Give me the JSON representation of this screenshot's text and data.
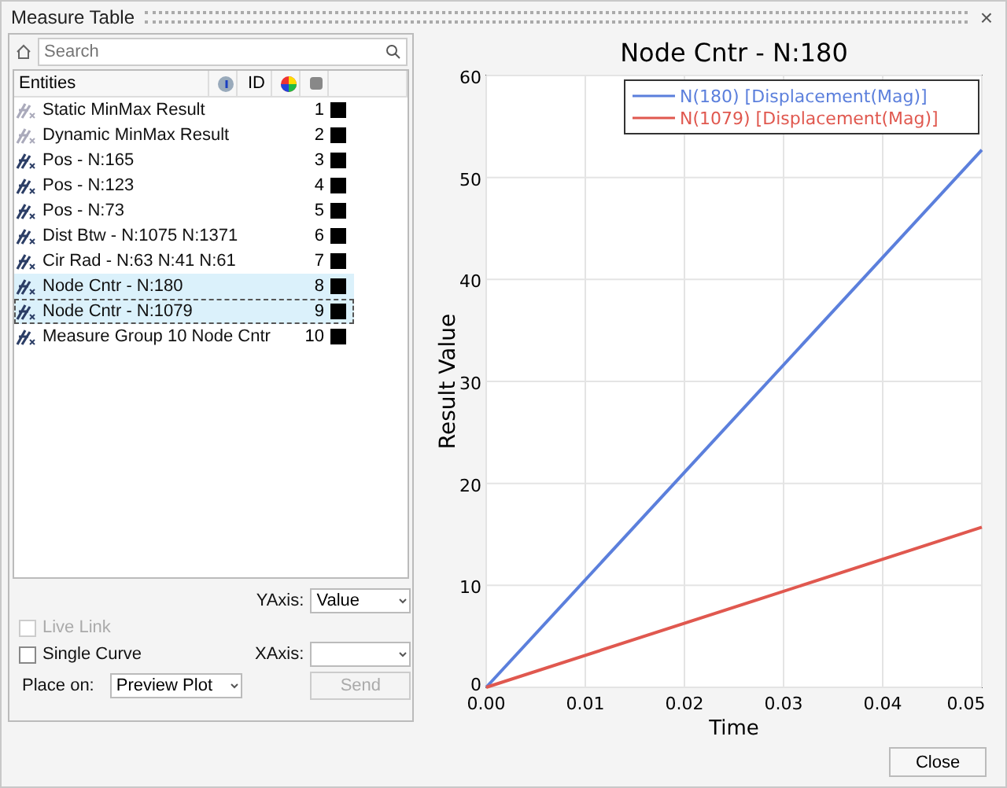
{
  "window": {
    "title": "Measure Table",
    "close": "×"
  },
  "search": {
    "placeholder": "Search"
  },
  "table": {
    "columns": [
      "Entities",
      "ID"
    ],
    "rows": [
      {
        "name": "Static MinMax Result",
        "id": "1",
        "enabled": false,
        "selected": false,
        "focused": false,
        "color": "#000000"
      },
      {
        "name": "Dynamic MinMax Result",
        "id": "2",
        "enabled": false,
        "selected": false,
        "focused": false,
        "color": "#000000"
      },
      {
        "name": "Pos -  N:165",
        "id": "3",
        "enabled": true,
        "selected": false,
        "focused": false,
        "color": "#000000"
      },
      {
        "name": "Pos -  N:123",
        "id": "4",
        "enabled": true,
        "selected": false,
        "focused": false,
        "color": "#000000"
      },
      {
        "name": "Pos -  N:73",
        "id": "5",
        "enabled": true,
        "selected": false,
        "focused": false,
        "color": "#000000"
      },
      {
        "name": "Dist Btw -  N:1075 N:1371",
        "id": "6",
        "enabled": true,
        "selected": false,
        "focused": false,
        "color": "#000000"
      },
      {
        "name": "Cir Rad -  N:63 N:41 N:61",
        "id": "7",
        "enabled": true,
        "selected": false,
        "focused": false,
        "color": "#000000"
      },
      {
        "name": "Node Cntr -  N:180",
        "id": "8",
        "enabled": true,
        "selected": true,
        "focused": false,
        "color": "#000000"
      },
      {
        "name": "Node Cntr -  N:1079",
        "id": "9",
        "enabled": true,
        "selected": true,
        "focused": true,
        "color": "#000000"
      },
      {
        "name": "Measure Group 10 Node Cntr",
        "id": "10",
        "enabled": true,
        "selected": false,
        "focused": false,
        "color": "#000000"
      }
    ]
  },
  "options": {
    "live_link": {
      "label": "Live Link",
      "checked": false,
      "disabled": true
    },
    "single_curve": {
      "label": "Single Curve",
      "checked": false,
      "disabled": false
    },
    "place_on": {
      "label": "Place on:",
      "value": "Preview Plot"
    },
    "yaxis": {
      "label": "YAxis:",
      "value": "Value"
    },
    "xaxis": {
      "label": "XAxis:"
    },
    "send": {
      "label": "Send",
      "disabled": true
    }
  },
  "chart": {
    "chart_data": {
      "type": "line",
      "title": "Node Cntr -  N:180",
      "xlabel": "Time",
      "ylabel": "Result Value",
      "x": [
        0,
        0.05
      ],
      "xlim": [
        0,
        0.05
      ],
      "ylim": [
        0,
        60
      ],
      "grid": true,
      "legend": "upper right",
      "xticks": [
        {
          "value": 0,
          "label": "0.00"
        },
        {
          "value": 0.01,
          "label": "0.01"
        },
        {
          "value": 0.02,
          "label": "0.02"
        },
        {
          "value": 0.03,
          "label": "0.03"
        },
        {
          "value": 0.04,
          "label": "0.04"
        },
        {
          "value": 0.05,
          "label": "0.05"
        }
      ],
      "yticks": [
        {
          "value": 0,
          "label": "0"
        },
        {
          "value": 10,
          "label": "10"
        },
        {
          "value": 20,
          "label": "20"
        },
        {
          "value": 30,
          "label": "30"
        },
        {
          "value": 40,
          "label": "40"
        },
        {
          "value": 50,
          "label": "50"
        },
        {
          "value": 60,
          "label": "60"
        }
      ],
      "series": [
        {
          "name": "N(180) [Displacement(Mag)]",
          "color": "#5b7fdc",
          "values": [
            0,
            52.7
          ]
        },
        {
          "name": "N(1079) [Displacement(Mag)]",
          "color": "#e0584f",
          "values": [
            0,
            15.7
          ]
        }
      ]
    }
  },
  "close_button": "Close"
}
